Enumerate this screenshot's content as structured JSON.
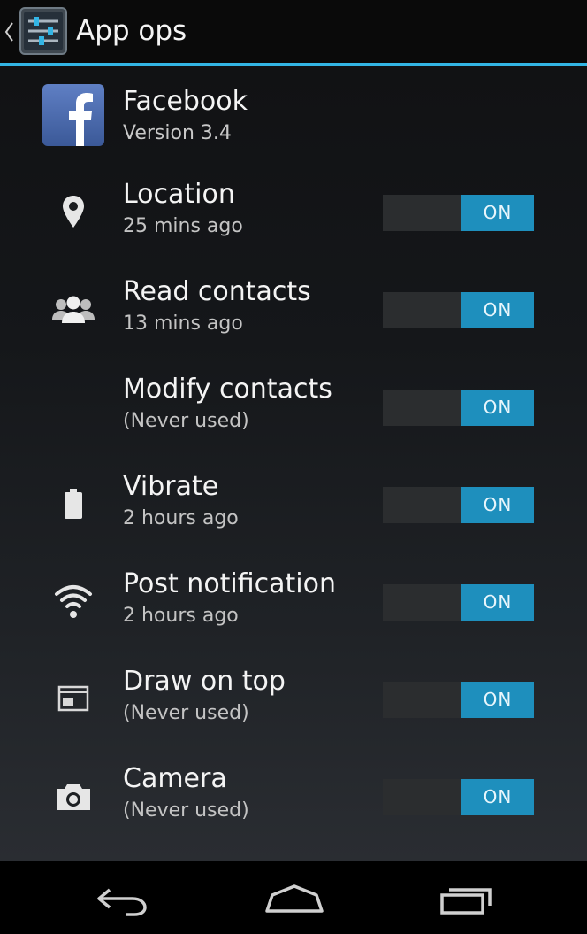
{
  "actionbar": {
    "title": "App ops",
    "accent_color": "#33b5e5",
    "back_icon": "chevron-left-icon",
    "app_icon": "settings-sliders-icon"
  },
  "app": {
    "name": "Facebook",
    "version": "Version 3.4",
    "icon": "facebook-logo"
  },
  "operations": [
    {
      "label": "Location",
      "last_used": "25 mins ago",
      "icon": "location-pin-icon",
      "state": "ON"
    },
    {
      "label": "Read contacts",
      "last_used": "13 mins ago",
      "icon": "contacts-icon",
      "state": "ON"
    },
    {
      "label": "Modify contacts",
      "last_used": "(Never used)",
      "icon": "",
      "state": "ON"
    },
    {
      "label": "Vibrate",
      "last_used": "2 hours ago",
      "icon": "battery-icon",
      "state": "ON"
    },
    {
      "label": "Post notification",
      "last_used": "2 hours ago",
      "icon": "wifi-icon",
      "state": "ON"
    },
    {
      "label": "Draw on top",
      "last_used": "(Never used)",
      "icon": "window-overlay-icon",
      "state": "ON"
    },
    {
      "label": "Camera",
      "last_used": "(Never used)",
      "icon": "camera-icon",
      "state": "ON"
    }
  ],
  "toggle_colors": {
    "on": "#1e8fbd",
    "track": "#2b2d2f"
  },
  "navbar": {
    "back": "nav-back-icon",
    "home": "nav-home-icon",
    "recents": "nav-recents-icon"
  }
}
